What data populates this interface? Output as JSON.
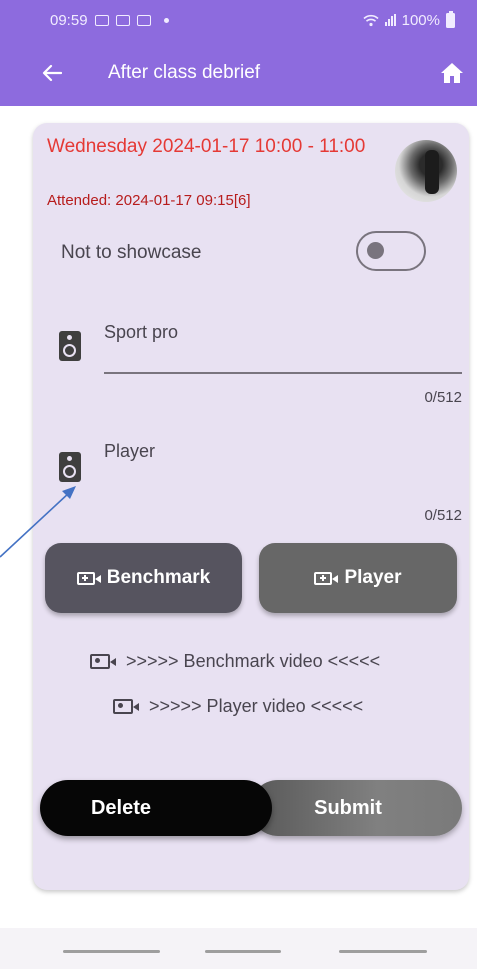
{
  "status_bar": {
    "time": "09:59",
    "battery": "100%"
  },
  "app_bar": {
    "title": "After class debrief",
    "back_icon": "arrow-left-icon",
    "home_icon": "home-icon"
  },
  "session": {
    "date_line": "Wednesday 2024-01-17 10:00 - 11:00",
    "attended": "Attended: 2024-01-17 09:15[6]"
  },
  "showcase": {
    "label": "Not to showcase",
    "enabled": false
  },
  "fields": {
    "sport_pro": {
      "label": "Sport pro",
      "counter": "0/512"
    },
    "player": {
      "label": "Player",
      "counter": "0/512"
    }
  },
  "buttons": {
    "benchmark": "Benchmark",
    "player": "Player",
    "delete": "Delete",
    "submit": "Submit"
  },
  "links": {
    "benchmark_video": ">>>>> Benchmark video <<<<<",
    "player_video": ">>>>> Player video <<<<<"
  },
  "colors": {
    "app_bar": "#8D6BDE",
    "card": "#E8E1F2",
    "date_text": "#E53935",
    "attended_text": "#B71C1C",
    "annotation_arrow": "#4472C4"
  }
}
